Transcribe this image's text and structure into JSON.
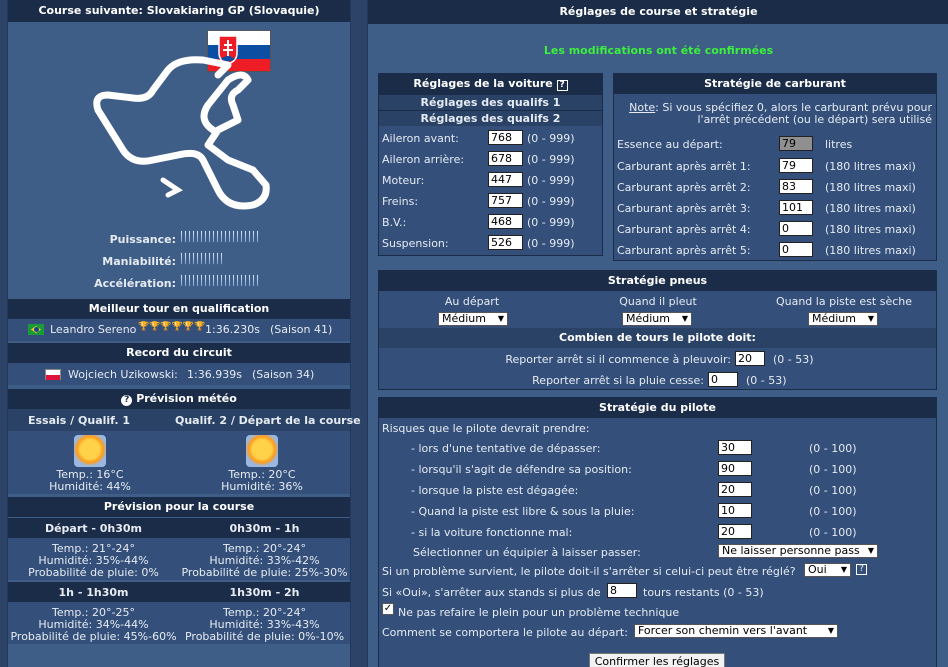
{
  "left": {
    "header": "Course suivante: Slovakiaring GP (Slovaquie)",
    "stats": [
      {
        "label": "Puissance:",
        "bars": 20
      },
      {
        "label": "Maniabilité:",
        "bars": 11
      },
      {
        "label": "Accélération:",
        "bars": 20
      }
    ],
    "best_qual_title": "Meilleur tour en qualification",
    "best_qual_driver": "Leandro Sereno",
    "best_qual_stars": "🏆🏆🏆🏆🏆🏆",
    "best_qual_time": "1:36.230s",
    "best_qual_season": "(Saison 41)",
    "record_title": "Record du circuit",
    "record_driver": "Wojciech Uzikowski:",
    "record_time": "1:36.939s",
    "record_season": "(Saison 34)",
    "weather_title": "Prévision météo",
    "weather_cols": [
      {
        "title": "Essais / Qualif. 1",
        "temp": "Temp.: 16°C",
        "hum": "Humidité: 44%"
      },
      {
        "title": "Qualif. 2 / Départ de la course",
        "temp": "Temp.: 20°C",
        "hum": "Humidité: 36%"
      }
    ],
    "race_forecast_title": "Prévision pour la course",
    "forecast": [
      {
        "title": "Départ - 0h30m",
        "temp": "Temp.: 21°-24°",
        "hum": "Humidité: 35%-44%",
        "rain": "Probabilité de pluie: 0%"
      },
      {
        "title": "0h30m - 1h",
        "temp": "Temp.: 20°-24°",
        "hum": "Humidité: 33%-42%",
        "rain": "Probabilité de pluie: 25%-30%"
      },
      {
        "title": "1h - 1h30m",
        "temp": "Temp.: 20°-25°",
        "hum": "Humidité: 34%-44%",
        "rain": "Probabilité de pluie: 45%-60%"
      },
      {
        "title": "1h30m - 2h",
        "temp": "Temp.: 20°-24°",
        "hum": "Humidité: 33%-43%",
        "rain": "Probabilité de pluie: 0%-10%"
      }
    ]
  },
  "right": {
    "header": "Réglages de course et stratégie",
    "confirm_msg": "Les modifications ont été confirmées",
    "car": {
      "title": "Réglages de la voiture",
      "help": "?",
      "qual1": "Réglages des qualifs 1",
      "qual2": "Réglages des qualifs 2",
      "rows": [
        {
          "label": "Aileron avant:",
          "value": "768",
          "range": "(0 - 999)"
        },
        {
          "label": "Aileron arrière:",
          "value": "678",
          "range": "(0 - 999)"
        },
        {
          "label": "Moteur:",
          "value": "447",
          "range": "(0 - 999)"
        },
        {
          "label": "Freins:",
          "value": "757",
          "range": "(0 - 999)"
        },
        {
          "label": "B.V.:",
          "value": "468",
          "range": "(0 - 999)"
        },
        {
          "label": "Suspension:",
          "value": "526",
          "range": "(0 - 999)"
        }
      ]
    },
    "fuel": {
      "title": "Stratégie de carburant",
      "note_label": "Note",
      "note_text": ": Si vous spécifiez 0, alors le carburant prévu pour l'arrêt précédent (ou le départ) sera utilisé",
      "start_label": "Essence au départ:",
      "start_value": "79",
      "start_unit": "litres",
      "rows": [
        {
          "label": "Carburant après arrêt 1:",
          "value": "79",
          "max": "(180 litres maxi)"
        },
        {
          "label": "Carburant après arrêt 2:",
          "value": "83",
          "max": "(180 litres maxi)"
        },
        {
          "label": "Carburant après arrêt 3:",
          "value": "101",
          "max": "(180 litres maxi)"
        },
        {
          "label": "Carburant après arrêt 4:",
          "value": "0",
          "max": "(180 litres maxi)"
        },
        {
          "label": "Carburant après arrêt 5:",
          "value": "0",
          "max": "(180 litres maxi)"
        }
      ]
    },
    "tyres": {
      "title": "Stratégie pneus",
      "cols": [
        {
          "label": "Au départ",
          "value": "Médium"
        },
        {
          "label": "Quand il pleut",
          "value": "Médium"
        },
        {
          "label": "Quand la piste est sèche",
          "value": "Médium"
        }
      ]
    },
    "laps": {
      "title": "Combien de tours le pilote doit:",
      "rain_label": "Reporter arrêt si il commence à pleuvoir:",
      "rain_value": "20",
      "rain_range": "(0 - 53)",
      "stop_label": "Reporter arrêt si la pluie cesse:",
      "stop_value": "0",
      "stop_range": "(0 - 53)"
    },
    "driver": {
      "title": "Stratégie du pilote",
      "intro": "Risques que le pilote devrait prendre:",
      "rows": [
        {
          "label": "- lors d'une tentative de dépasser:",
          "value": "30",
          "range": "(0 - 100)"
        },
        {
          "label": "- lorsqu'il s'agit de défendre sa position:",
          "value": "90",
          "range": "(0 - 100)"
        },
        {
          "label": "- lorsque la piste est dégagée:",
          "value": "20",
          "range": "(0 - 100)"
        },
        {
          "label": "- Quand la piste est libre & sous la pluie:",
          "value": "10",
          "range": "(0 - 100)"
        },
        {
          "label": "- si la voiture fonctionne mal:",
          "value": "20",
          "range": "(0 - 100)"
        }
      ],
      "let_pass_label": "Sélectionner un équipier à laisser passer:",
      "let_pass_value": "Ne laisser personne pass",
      "problem_label": "Si un problème survient, le pilote doit-il s'arrêter si celui-ci peut être réglé?",
      "problem_value": "Oui",
      "help": "?",
      "pit_prefix": "Si «Oui», s'arrêter aux stands si plus de",
      "pit_value": "8",
      "pit_suffix": "tours restants (0 - 53)",
      "no_refuel_label": "Ne pas refaire le plein pour un problème technique",
      "start_behavior_label": "Comment se comportera le pilote au départ:",
      "start_behavior_value": "Forcer son chemin vers l'avant",
      "confirm_button": "Confirmer les réglages"
    }
  }
}
